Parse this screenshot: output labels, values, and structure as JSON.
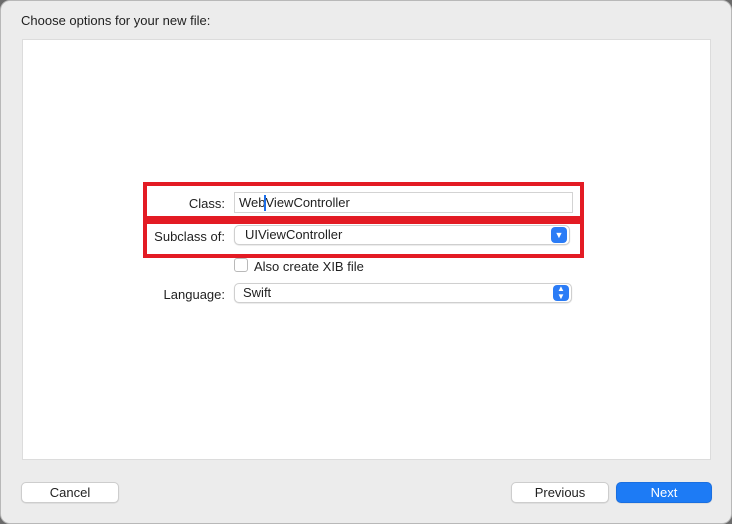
{
  "dialog": {
    "title": "Choose options for your new file:"
  },
  "form": {
    "class_label": "Class:",
    "class_value": "WebViewController",
    "subclass_label": "Subclass of:",
    "subclass_value": "UIViewController",
    "xib_label": "Also create XIB file",
    "xib_checked": false,
    "language_label": "Language:",
    "language_value": "Swift"
  },
  "buttons": {
    "cancel": "Cancel",
    "previous": "Previous",
    "next": "Next"
  },
  "colors": {
    "accent": "#1d7bf5",
    "highlight": "#e31b24"
  }
}
